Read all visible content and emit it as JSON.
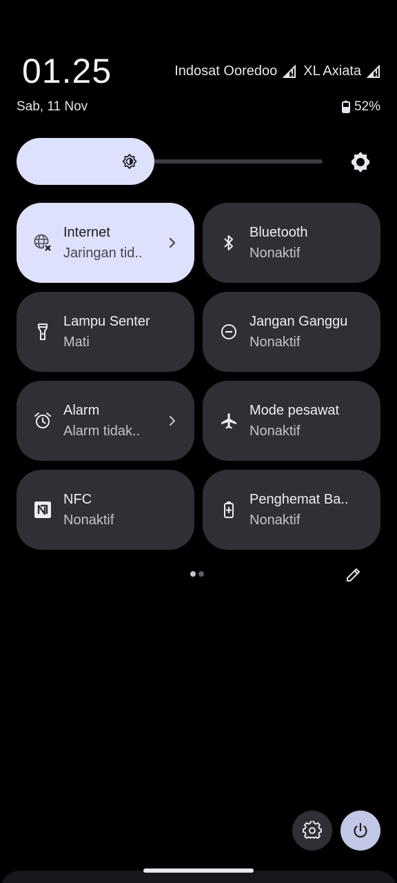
{
  "status": {
    "time": "01.25",
    "date": "Sab, 11 Nov",
    "carriers": [
      {
        "name": "Indosat Ooredoo",
        "icon": "signal-icon"
      },
      {
        "name": "XL Axiata",
        "icon": "signal-icon"
      }
    ],
    "battery": "52%"
  },
  "brightness": {
    "level": 0.45,
    "icon": "brightness-icon",
    "settings_icon": "brightness-settings-icon"
  },
  "tiles": [
    {
      "label": "Internet",
      "sub": "Jaringan tid..",
      "icon": "internet-icon",
      "active": true,
      "chevron": true
    },
    {
      "label": "Bluetooth",
      "sub": "Nonaktif",
      "icon": "bluetooth-icon",
      "active": false,
      "chevron": false
    },
    {
      "label": "Lampu Senter",
      "sub": "Mati",
      "icon": "flashlight-icon",
      "active": false,
      "chevron": false
    },
    {
      "label": "Jangan Ganggu",
      "sub": "Nonaktif",
      "icon": "dnd-icon",
      "active": false,
      "chevron": false
    },
    {
      "label": "Alarm",
      "sub": "Alarm tidak..",
      "icon": "alarm-icon",
      "active": false,
      "chevron": true
    },
    {
      "label": "Mode pesawat",
      "sub": "Nonaktif",
      "icon": "airplane-icon",
      "active": false,
      "chevron": false
    },
    {
      "label": "NFC",
      "sub": "Nonaktif",
      "icon": "nfc-icon",
      "active": false,
      "chevron": false
    },
    {
      "label": "Penghemat Ba..",
      "sub": "Nonaktif",
      "icon": "battery-saver-icon",
      "active": false,
      "chevron": false
    }
  ],
  "pager": {
    "pages": 2,
    "current": 1
  },
  "colors": {
    "tile_active": "#dde1fb",
    "tile_inactive": "#2e3036",
    "power_button": "#c3c7e6"
  }
}
